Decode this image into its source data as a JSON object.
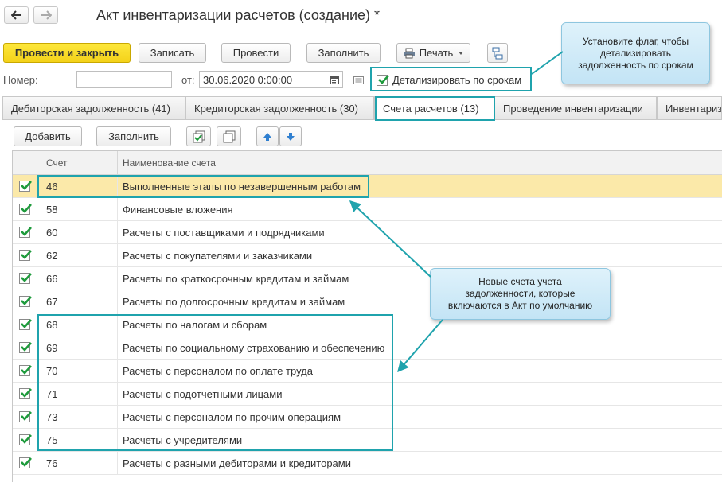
{
  "window": {
    "title": "Акт инвентаризации расчетов (создание) *"
  },
  "toolbar": {
    "post_close_label": "Провести и закрыть",
    "save_label": "Записать",
    "post_label": "Провести",
    "fill_label": "Заполнить",
    "print_label": "Печать"
  },
  "header": {
    "number_label": "Номер:",
    "number_value": "",
    "date_label": "от:",
    "date_value": "30.06.2020  0:00:00",
    "detail_checkbox_label": "Детализировать по срокам",
    "detail_checked": true
  },
  "tabs": [
    {
      "label": "Дебиторская задолженность (41)"
    },
    {
      "label": "Кредиторская задолженность (30)"
    },
    {
      "label": "Счета расчетов (13)"
    },
    {
      "label": "Проведение инвентаризации"
    },
    {
      "label": "Инвентариза"
    }
  ],
  "table_toolbar": {
    "add_label": "Добавить",
    "fill_label": "Заполнить"
  },
  "table": {
    "columns": [
      "Счет",
      "Наименование счета"
    ],
    "rows": [
      {
        "code": "46",
        "name": "Выполненные этапы по незавершенным работам",
        "checked": true,
        "selected": true
      },
      {
        "code": "58",
        "name": "Финансовые вложения",
        "checked": true
      },
      {
        "code": "60",
        "name": "Расчеты с поставщиками и подрядчиками",
        "checked": true
      },
      {
        "code": "62",
        "name": "Расчеты с покупателями и заказчиками",
        "checked": true
      },
      {
        "code": "66",
        "name": "Расчеты по краткосрочным кредитам и займам",
        "checked": true
      },
      {
        "code": "67",
        "name": "Расчеты по долгосрочным кредитам и займам",
        "checked": true
      },
      {
        "code": "68",
        "name": "Расчеты по налогам и сборам",
        "checked": true
      },
      {
        "code": "69",
        "name": "Расчеты по социальному страхованию и обеспечению",
        "checked": true
      },
      {
        "code": "70",
        "name": "Расчеты с персоналом по оплате труда",
        "checked": true
      },
      {
        "code": "71",
        "name": "Расчеты с подотчетными лицами",
        "checked": true
      },
      {
        "code": "73",
        "name": "Расчеты с персоналом по прочим операциям",
        "checked": true
      },
      {
        "code": "75",
        "name": "Расчеты с учредителями",
        "checked": true
      },
      {
        "code": "76",
        "name": "Расчеты с разными дебиторами и кредиторами",
        "checked": true
      }
    ]
  },
  "callouts": {
    "flag_hint": [
      "Установите флаг, чтобы",
      "детализировать",
      "задолженность по срокам"
    ],
    "new_accounts_hint": [
      "Новые счета учета",
      "задолженности, которые",
      "включаются в Акт по умолчанию"
    ]
  },
  "colors": {
    "primary_button": "#f4d21a",
    "selected_row": "#fbe9a9",
    "check_green": "#1e9b3c",
    "highlight_frame": "#1fa3ad",
    "callout_fill": "#c3e4f5"
  }
}
